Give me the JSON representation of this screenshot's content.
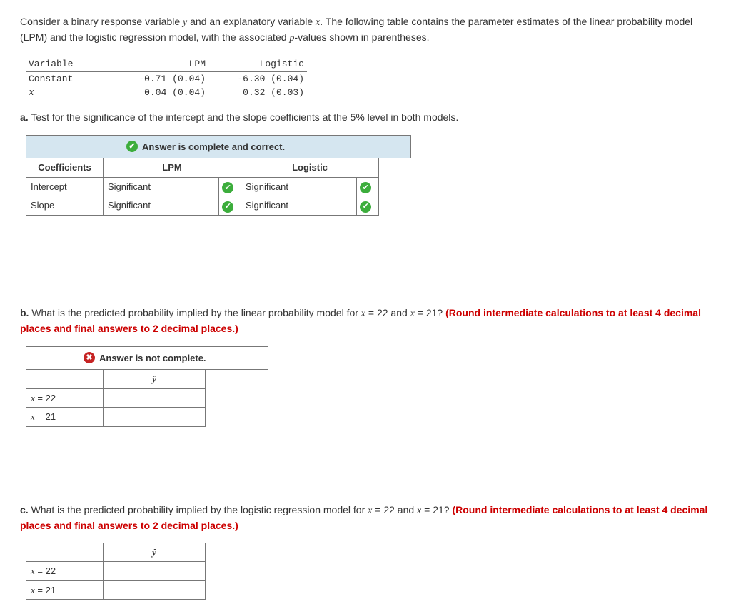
{
  "intro": {
    "text1": "Consider a binary response variable ",
    "var_y": "y",
    "text2": " and an explanatory variable ",
    "var_x": "x",
    "text3": ". The following table contains the parameter estimates of the linear probability model (LPM) and the logistic regression model, with the associated ",
    "var_p": "p",
    "text4": "-values shown in parentheses."
  },
  "param_table": {
    "headers": {
      "c1": "Variable",
      "c2": "LPM",
      "c3": "Logistic"
    },
    "rows": [
      {
        "c1": "Constant",
        "c2": "-0.71 (0.04)",
        "c3": "-6.30 (0.04)"
      },
      {
        "c1": "x",
        "c2": " 0.04 (0.04)",
        "c3": " 0.32 (0.03)"
      }
    ]
  },
  "part_a": {
    "label": "a.",
    "text": " Test for the significance of the intercept and the slope coefficients at the 5% level in both models.",
    "banner": "Answer is complete and correct.",
    "table": {
      "headers": {
        "c1": "Coefficients",
        "c2": "LPM",
        "c3": "Logistic"
      },
      "rows": [
        {
          "label": "Intercept",
          "lpm": "Significant",
          "log": "Significant"
        },
        {
          "label": "Slope",
          "lpm": "Significant",
          "log": "Significant"
        }
      ]
    }
  },
  "part_b": {
    "label": "b.",
    "text1": " What is the predicted probability implied by the linear probability model for ",
    "x1": "x",
    "eq1": " = 22 and ",
    "x2": "x",
    "eq2": " = 21? ",
    "hint": "(Round intermediate calculations to at least 4 decimal places and final answers to 2 decimal places.)",
    "banner": "Answer is not complete.",
    "yhat": "ŷ",
    "rows": [
      {
        "label": "x = 22",
        "val": ""
      },
      {
        "label": "x = 21",
        "val": ""
      }
    ]
  },
  "part_c": {
    "label": "c.",
    "text1": " What is the predicted probability implied by the logistic regression model for ",
    "x1": "x",
    "eq1": " = 22 and ",
    "x2": "x",
    "eq2": " = 21? ",
    "hint": "(Round intermediate calculations to at least 4 decimal places and final answers to 2 decimal places.)",
    "yhat": "ŷ",
    "rows": [
      {
        "label": "x = 22",
        "val": ""
      },
      {
        "label": "x = 21",
        "val": ""
      }
    ]
  }
}
